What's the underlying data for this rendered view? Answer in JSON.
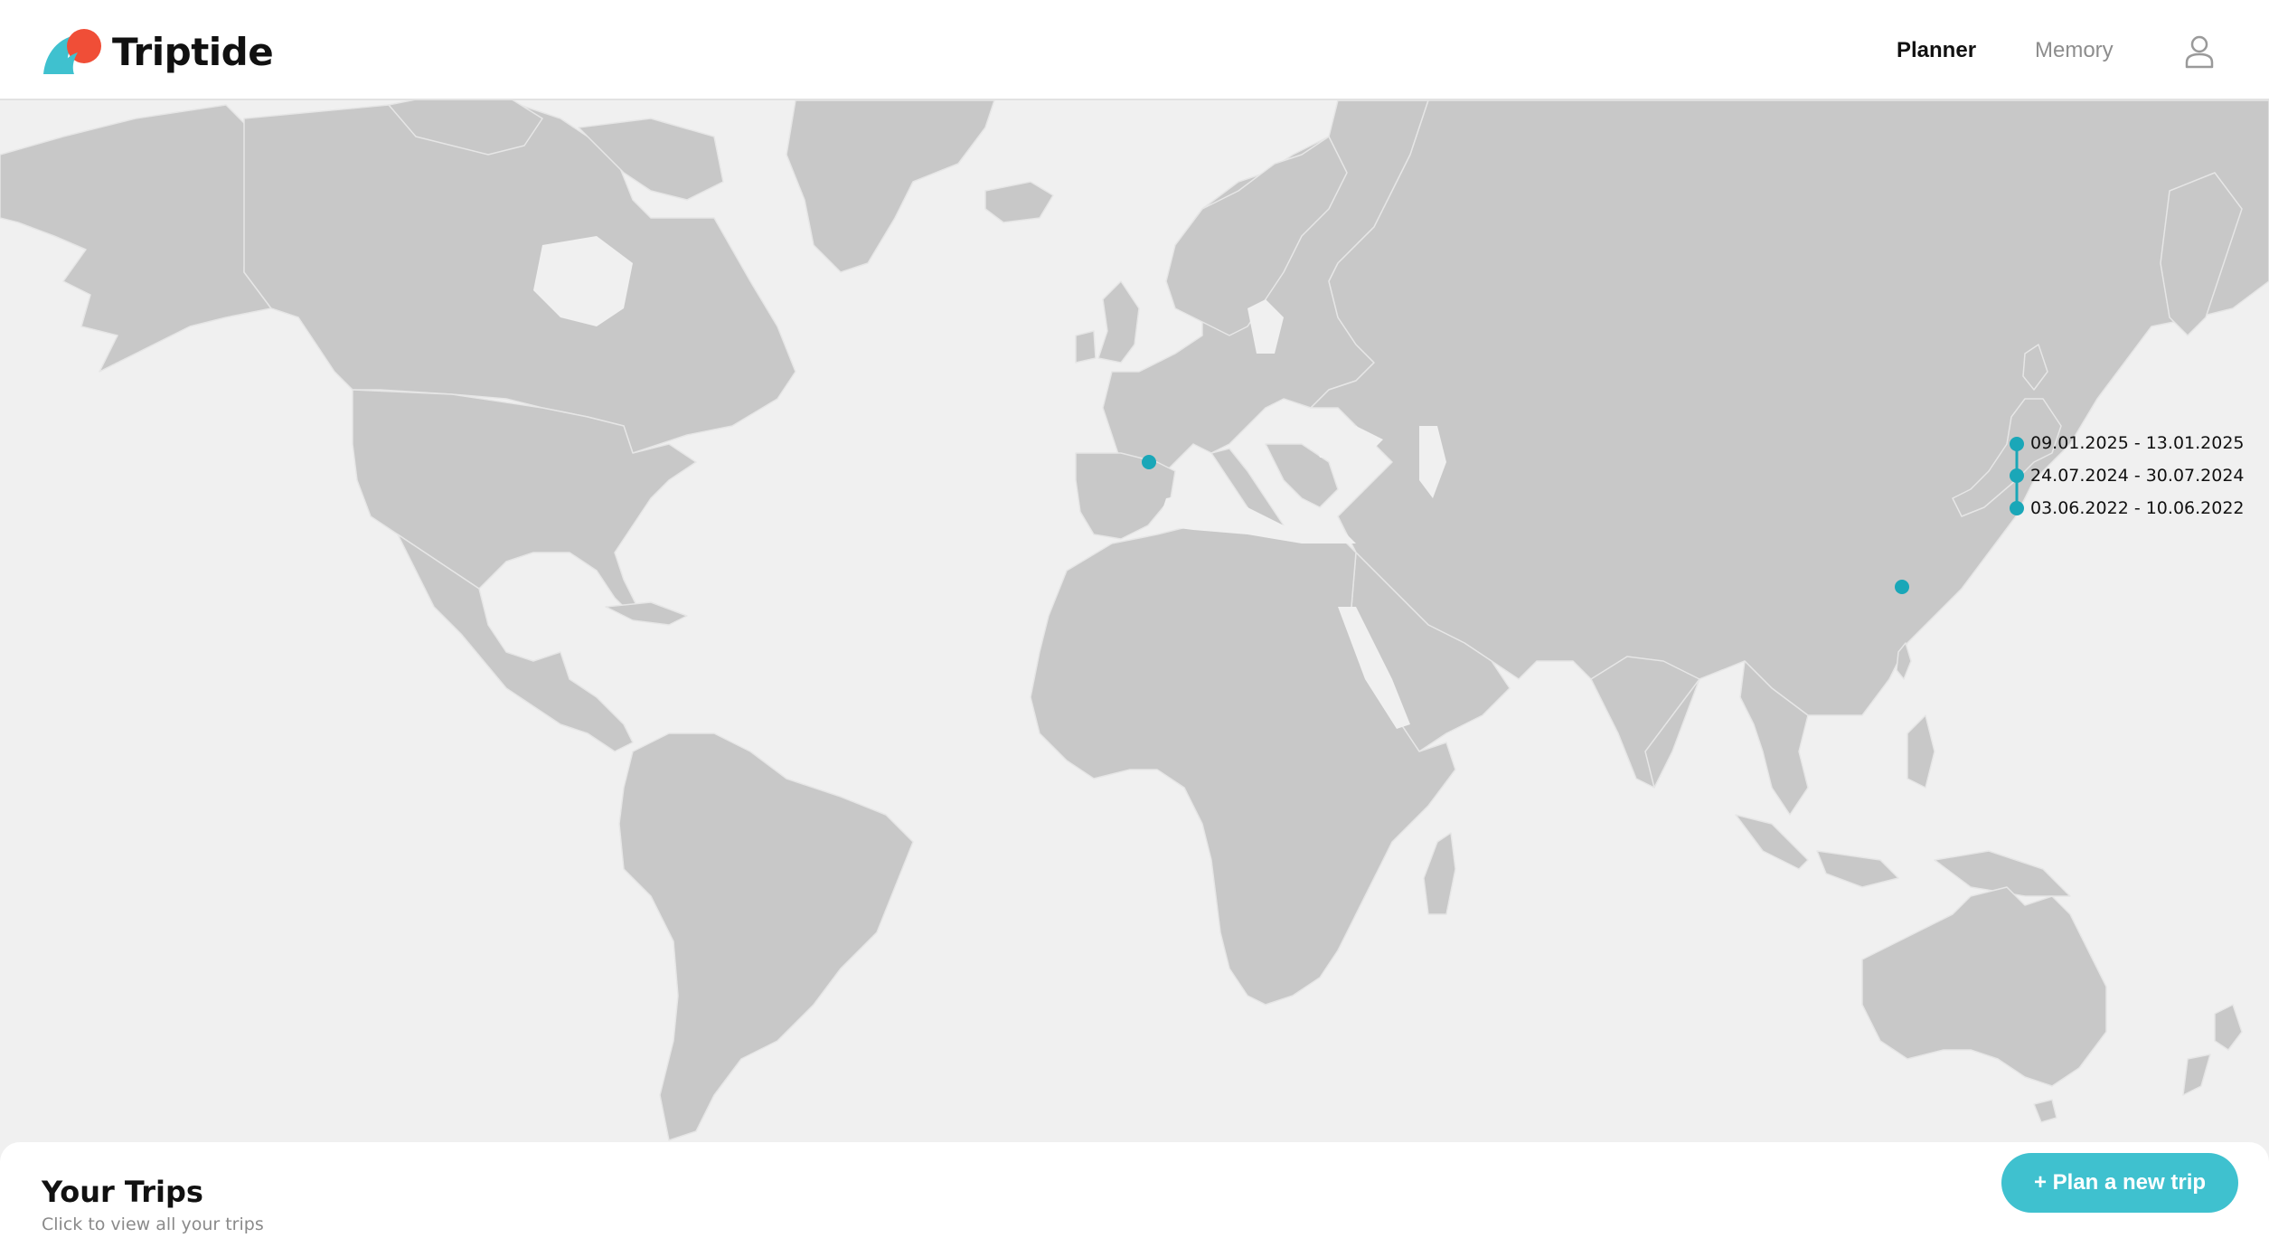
{
  "app": {
    "name": "Triptide",
    "logo_icon": "wave-sun-logo",
    "colors": {
      "teal": "#3fc1cf",
      "sun": "#f04e37",
      "land": "#c8c8c8",
      "sea": "#f0f0f0",
      "pin": "#1aa7b8"
    }
  },
  "nav": {
    "planner": "Planner",
    "memory": "Memory",
    "user_icon": "user-icon"
  },
  "map": {
    "pins": [
      {
        "name": "spain",
        "label": ""
      },
      {
        "name": "taiwan",
        "label": ""
      },
      {
        "name": "japan-1",
        "label": "09.01.2025 - 13.01.2025"
      },
      {
        "name": "japan-2",
        "label": "24.07.2024 - 30.07.2024"
      },
      {
        "name": "japan-3",
        "label": "03.06.2022 - 10.06.2022"
      }
    ]
  },
  "trips_panel": {
    "title": "Your Trips",
    "subtitle": "Click to view all your trips",
    "plan_button": "+ Plan a new trip"
  }
}
